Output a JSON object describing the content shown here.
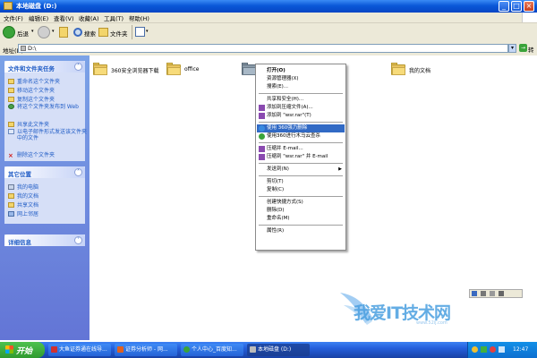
{
  "window": {
    "title": "本地磁盘 (D:)",
    "buttons": {
      "minimize": "_",
      "maximize": "□",
      "close": "×"
    }
  },
  "menubar": {
    "items": [
      "文件(F)",
      "编辑(E)",
      "查看(V)",
      "收藏(A)",
      "工具(T)",
      "帮助(H)"
    ]
  },
  "toolbar": {
    "back": "后退",
    "search": "搜索",
    "folders": "文件夹"
  },
  "address": {
    "label": "地址(D)",
    "value": "D:\\",
    "go": "转到"
  },
  "sidebar": {
    "file_tasks": {
      "title": "文件和文件夹任务",
      "items": [
        "重命名这个文件夹",
        "移动这个文件夹",
        "复制这个文件夹",
        "将这个文件夹发布到 Web",
        "共享此文件夹",
        "以电子邮件形式发送该文件夹中的文件",
        "删除这个文件夹"
      ]
    },
    "other_places": {
      "title": "其它位置",
      "items": [
        "我的电脑",
        "我的文档",
        "共享文档",
        "网上邻居"
      ]
    },
    "details": {
      "title": "详细信息"
    }
  },
  "folders": [
    {
      "label": "360安全浏览器下载"
    },
    {
      "label": "office"
    },
    {
      "label": ""
    },
    {
      "label": "我的文档"
    }
  ],
  "context_menu": {
    "items": [
      "打开(O)",
      "资源管理器(X)",
      "搜索(E)...",
      "共享和安全(H)...",
      "添加到压缩文件(A)...",
      "添加到 \"wsr.rar\"(T)",
      "使用 360强力删除",
      "使用360进行木马云查杀",
      "压缩并 E-mail...",
      "压缩到 \"wsr.rar\" 并 E-mail",
      "发送到(N)",
      "剪切(T)",
      "复制(C)",
      "创建快捷方式(S)",
      "删除(D)",
      "重命名(M)",
      "属性(R)"
    ]
  },
  "taskbar": {
    "start": "开始",
    "tasks": [
      "大鱼证券通在线导...",
      "证券分析师 - 网...",
      "个人中心_百度知...",
      "本地磁盘 (D:)"
    ],
    "clock": "12:47"
  },
  "watermark": {
    "text": "我爱IT技术网",
    "url": "www.52ij.com"
  },
  "colors": {
    "titlebar": "#0a58d8",
    "highlight": "#316ac5",
    "sidebar_bg": "#6375d6",
    "panel_link": "#215dc6",
    "start_green": "#2f9a2f"
  }
}
